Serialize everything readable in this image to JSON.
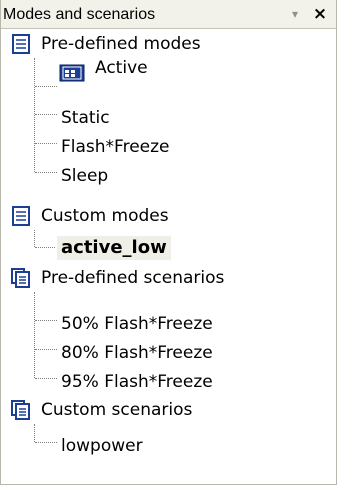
{
  "panel": {
    "title": "Modes and scenarios",
    "pin_glyph": "▾",
    "close_glyph": "×"
  },
  "tree": {
    "predefined_modes": {
      "label": "Pre-defined modes",
      "icon": "document-list-icon",
      "items": [
        "Active",
        "Static",
        "Flash*Freeze",
        "Sleep"
      ]
    },
    "custom_modes": {
      "label": "Custom modes",
      "icon": "document-list-icon",
      "items": [
        "active_low"
      ],
      "selected": "active_low"
    },
    "predefined_scenarios": {
      "label": "Pre-defined scenarios",
      "icon": "stacked-documents-icon",
      "items": [
        "50% Flash*Freeze",
        "80% Flash*Freeze",
        "95% Flash*Freeze"
      ]
    },
    "custom_scenarios": {
      "label": "Custom scenarios",
      "icon": "stacked-documents-icon",
      "items": [
        "lowpower"
      ]
    }
  },
  "colors": {
    "icon_blue": "#1c3f95",
    "icon_fill": "#ffffff",
    "selection_bg": "#f0efe7",
    "titlebar_bg": "#f2f1ea"
  }
}
